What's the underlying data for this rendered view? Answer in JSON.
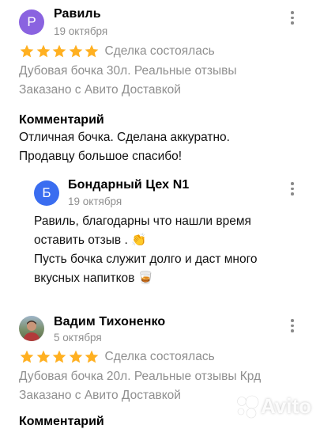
{
  "reviews": [
    {
      "avatar_letter": "Р",
      "avatar_color": "#8a63e0",
      "name": "Равиль",
      "date": "19 октября",
      "rating": 5,
      "deal_status": "Сделка состоялась",
      "item": "Дубовая бочка 30л. Реальные отзывы",
      "delivery": "Заказано с Авито Доставкой",
      "comment_title": "Комментарий",
      "comment_lines": [
        "Отличная бочка. Сделана аккуратно.",
        "Продавцу большое спасибо!"
      ]
    },
    {
      "avatar_letter": "",
      "name": "Вадим Тихоненко",
      "date": "5 октября",
      "rating": 5,
      "deal_status": "Сделка состоялась",
      "item": "Дубовая бочка 20л. Реальные отзывы Крд",
      "delivery": "Заказано с Авито Доставкой",
      "comment_title": "Комментарий"
    }
  ],
  "reply": {
    "avatar_letter": "Б",
    "avatar_color": "#3a6df0",
    "name": "Бондарный Цех N1",
    "date": "19 октября",
    "lines": [
      "Равиль, благодарны что нашли время",
      "оставить отзыв . 👏",
      "Пусть бочка служит долго и даст много",
      "вкусных напитков 🥃"
    ]
  },
  "colors": {
    "star": "#ffb021",
    "muted": "#8f8f8f"
  },
  "watermark": {
    "text": "Avito",
    "icon": "avito-dots-logo"
  }
}
